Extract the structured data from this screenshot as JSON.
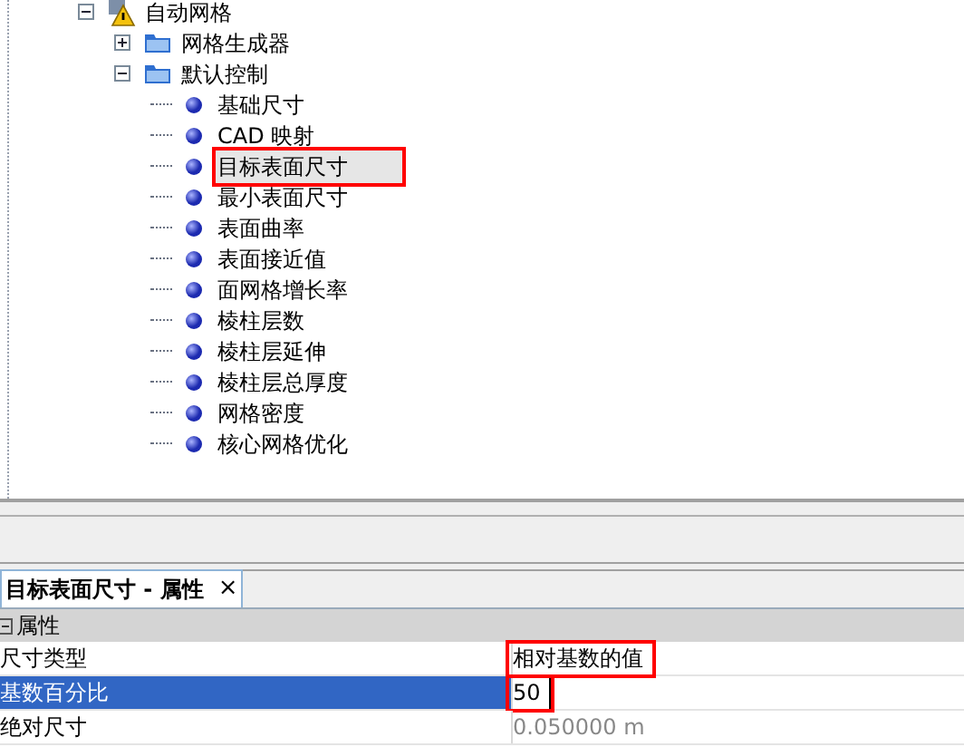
{
  "tree": [
    {
      "label": "自动网格",
      "kind": "node",
      "expanded": true,
      "children": [
        {
          "label": "网格生成器",
          "kind": "folder",
          "expanded": false
        },
        {
          "label": "默认控制",
          "kind": "folder",
          "expanded": true,
          "children": [
            {
              "label": "基础尺寸",
              "kind": "item",
              "selected": false,
              "highlighted": false
            },
            {
              "label": "CAD 映射",
              "kind": "item",
              "selected": false,
              "highlighted": false
            },
            {
              "label": "目标表面尺寸",
              "kind": "item",
              "selected": true,
              "highlighted": true
            },
            {
              "label": "最小表面尺寸",
              "kind": "item",
              "selected": false,
              "highlighted": false
            },
            {
              "label": "表面曲率",
              "kind": "item",
              "selected": false,
              "highlighted": false
            },
            {
              "label": "表面接近值",
              "kind": "item",
              "selected": false,
              "highlighted": false
            },
            {
              "label": "面网格增长率",
              "kind": "item",
              "selected": false,
              "highlighted": false
            },
            {
              "label": "棱柱层数",
              "kind": "item",
              "selected": false,
              "highlighted": false
            },
            {
              "label": "棱柱层延伸",
              "kind": "item",
              "selected": false,
              "highlighted": false
            },
            {
              "label": "棱柱层总厚度",
              "kind": "item",
              "selected": false,
              "highlighted": false
            },
            {
              "label": "网格密度",
              "kind": "item",
              "selected": false,
              "highlighted": false
            },
            {
              "label": "核心网格优化",
              "kind": "item",
              "selected": false,
              "highlighted": false
            }
          ]
        }
      ]
    }
  ],
  "properties_panel": {
    "tab": {
      "label": "目标表面尺寸 - 属性",
      "close": "×"
    },
    "group": {
      "label": "属性",
      "expanded": true
    },
    "rows": [
      {
        "name": "尺寸类型",
        "value": "相对基数的值",
        "selected": false,
        "editing": false,
        "disabled": false,
        "highlighted": true
      },
      {
        "name": "基数百分比",
        "value": "50",
        "selected": true,
        "editing": true,
        "disabled": false,
        "highlighted": true
      },
      {
        "name": "绝对尺寸",
        "value": "0.050000 m",
        "selected": false,
        "editing": false,
        "disabled": true,
        "highlighted": false
      }
    ]
  }
}
